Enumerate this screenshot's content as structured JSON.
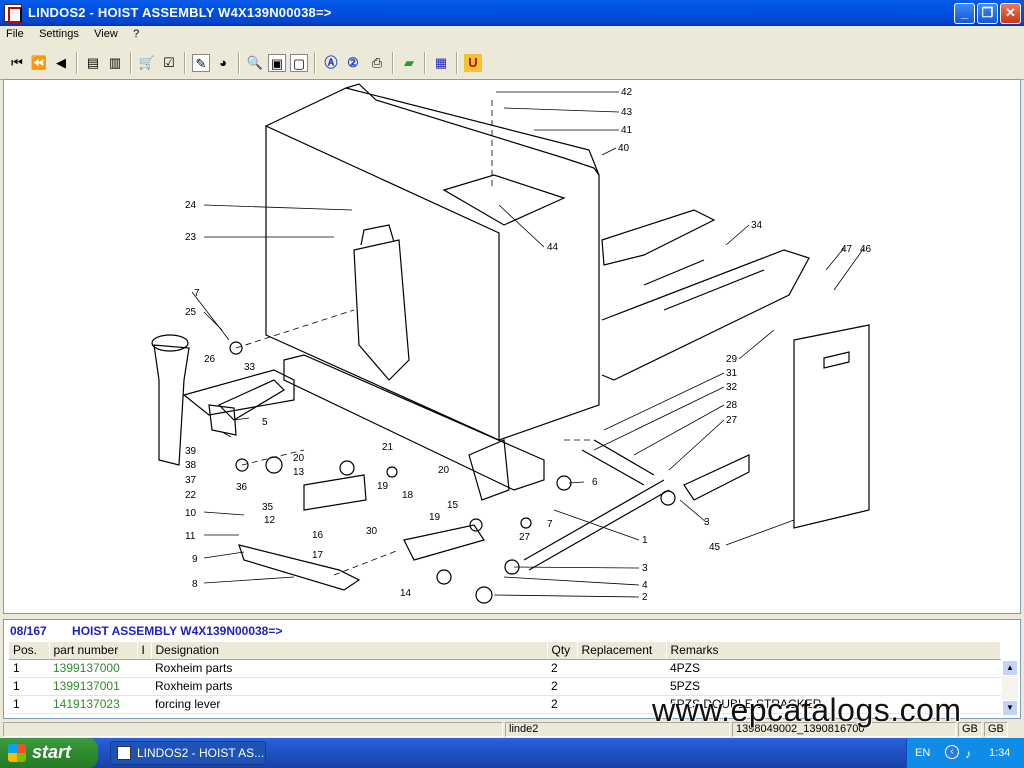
{
  "window": {
    "title": "LINDOS2 - HOIST ASSEMBLY W4X139N00038=>"
  },
  "menu": [
    "File",
    "Settings",
    "View",
    "?"
  ],
  "toolbar_icons": [
    "first-icon",
    "prev-fast-icon",
    "prev-icon",
    "doc-open-icon",
    "doc-list-icon",
    "cart-icon",
    "checklist-icon",
    "pen-icon",
    "globe-icon",
    "zoom-icon",
    "page-icon",
    "page-fit-icon",
    "a-circle-icon",
    "two-circle-icon",
    "print-icon",
    "green-book-icon",
    "grid-icon",
    "u-icon"
  ],
  "drawing": {
    "callouts": [
      "1",
      "2",
      "3",
      "4",
      "5",
      "6",
      "7",
      "8",
      "9",
      "10",
      "11",
      "12",
      "13",
      "14",
      "15",
      "16",
      "17",
      "18",
      "19",
      "20",
      "21",
      "22",
      "23",
      "24",
      "25",
      "26",
      "27",
      "28",
      "29",
      "30",
      "31",
      "32",
      "33",
      "34",
      "35",
      "36",
      "37",
      "38",
      "39",
      "40",
      "41",
      "42",
      "43",
      "44",
      "45",
      "46",
      "47"
    ]
  },
  "parts": {
    "code": "08/167",
    "title": "HOIST ASSEMBLY W4X139N00038=>",
    "columns": [
      "Pos.",
      "part number",
      "I",
      "Designation",
      "Qty",
      "Replacement",
      "Remarks"
    ],
    "rows": [
      {
        "pos": "1",
        "part_number": "1399137000",
        "i": "",
        "designation": "Roxheim parts",
        "qty": "2",
        "replacement": "",
        "remarks": "4PZS"
      },
      {
        "pos": "1",
        "part_number": "1399137001",
        "i": "",
        "designation": "Roxheim parts",
        "qty": "2",
        "replacement": "",
        "remarks": "5PZS"
      },
      {
        "pos": "1",
        "part_number": "1419137023",
        "i": "",
        "designation": "forcing lever",
        "qty": "2",
        "replacement": "",
        "remarks": "5PZS DOUBLE STRACKER"
      }
    ]
  },
  "status": {
    "cell2": "linde2",
    "cell3": "1398049002_1390816700",
    "lang1": "GB",
    "lang2": "GB"
  },
  "watermark": "www.epcatalogs.com",
  "taskbar": {
    "start": "start",
    "item": "LINDOS2 - HOIST AS...",
    "lang": "EN",
    "time": "1:34"
  }
}
